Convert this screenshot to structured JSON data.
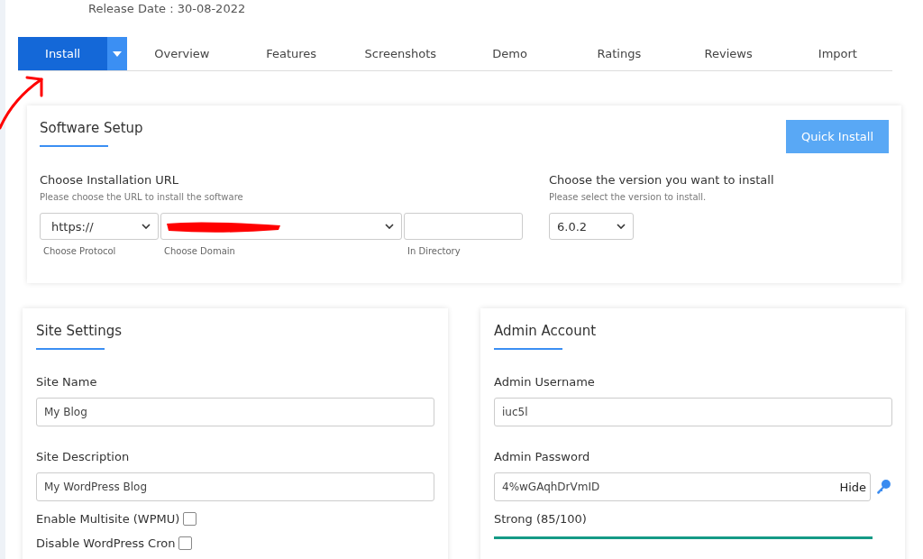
{
  "release_date": "Release Date : 30-08-2022",
  "tabs": [
    {
      "label": "Install",
      "selected": true,
      "dropdown": true
    },
    {
      "label": "Overview",
      "selected": false,
      "dropdown": false
    },
    {
      "label": "Features",
      "selected": false,
      "dropdown": false
    },
    {
      "label": "Screenshots",
      "selected": false,
      "dropdown": false
    },
    {
      "label": "Demo",
      "selected": false,
      "dropdown": false
    },
    {
      "label": "Ratings",
      "selected": false,
      "dropdown": false
    },
    {
      "label": "Reviews",
      "selected": false,
      "dropdown": false
    },
    {
      "label": "Import",
      "selected": false,
      "dropdown": false
    }
  ],
  "software_setup": {
    "title": "Software Setup",
    "quick_install": "Quick Install",
    "url": {
      "label": "Choose Installation URL",
      "hint": "Please choose the URL to install the software",
      "protocol": {
        "value": "https://",
        "caption": "Choose Protocol"
      },
      "domain": {
        "caption": "Choose Domain"
      },
      "directory": {
        "caption": "In Directory"
      }
    },
    "version": {
      "label": "Choose the version you want to install",
      "hint": "Please select the version to install.",
      "value": "6.0.2"
    }
  },
  "site_settings": {
    "title": "Site Settings",
    "fields": [
      {
        "label": "Site Name",
        "value": "My Blog"
      },
      {
        "label": "Site Description",
        "value": "My WordPress Blog"
      }
    ],
    "options": [
      {
        "label": "Enable Multisite (WPMU)",
        "checked": false
      },
      {
        "label": "Disable WordPress Cron",
        "checked": false
      }
    ]
  },
  "admin_account": {
    "title": "Admin Account",
    "username": {
      "label": "Admin Username",
      "value": "iuc5l"
    },
    "password": {
      "label": "Admin Password",
      "value": "4%wGAqhDrVmID",
      "toggle": "Hide"
    },
    "strength": {
      "text": "Strong (85/100)",
      "level": 1
    }
  }
}
